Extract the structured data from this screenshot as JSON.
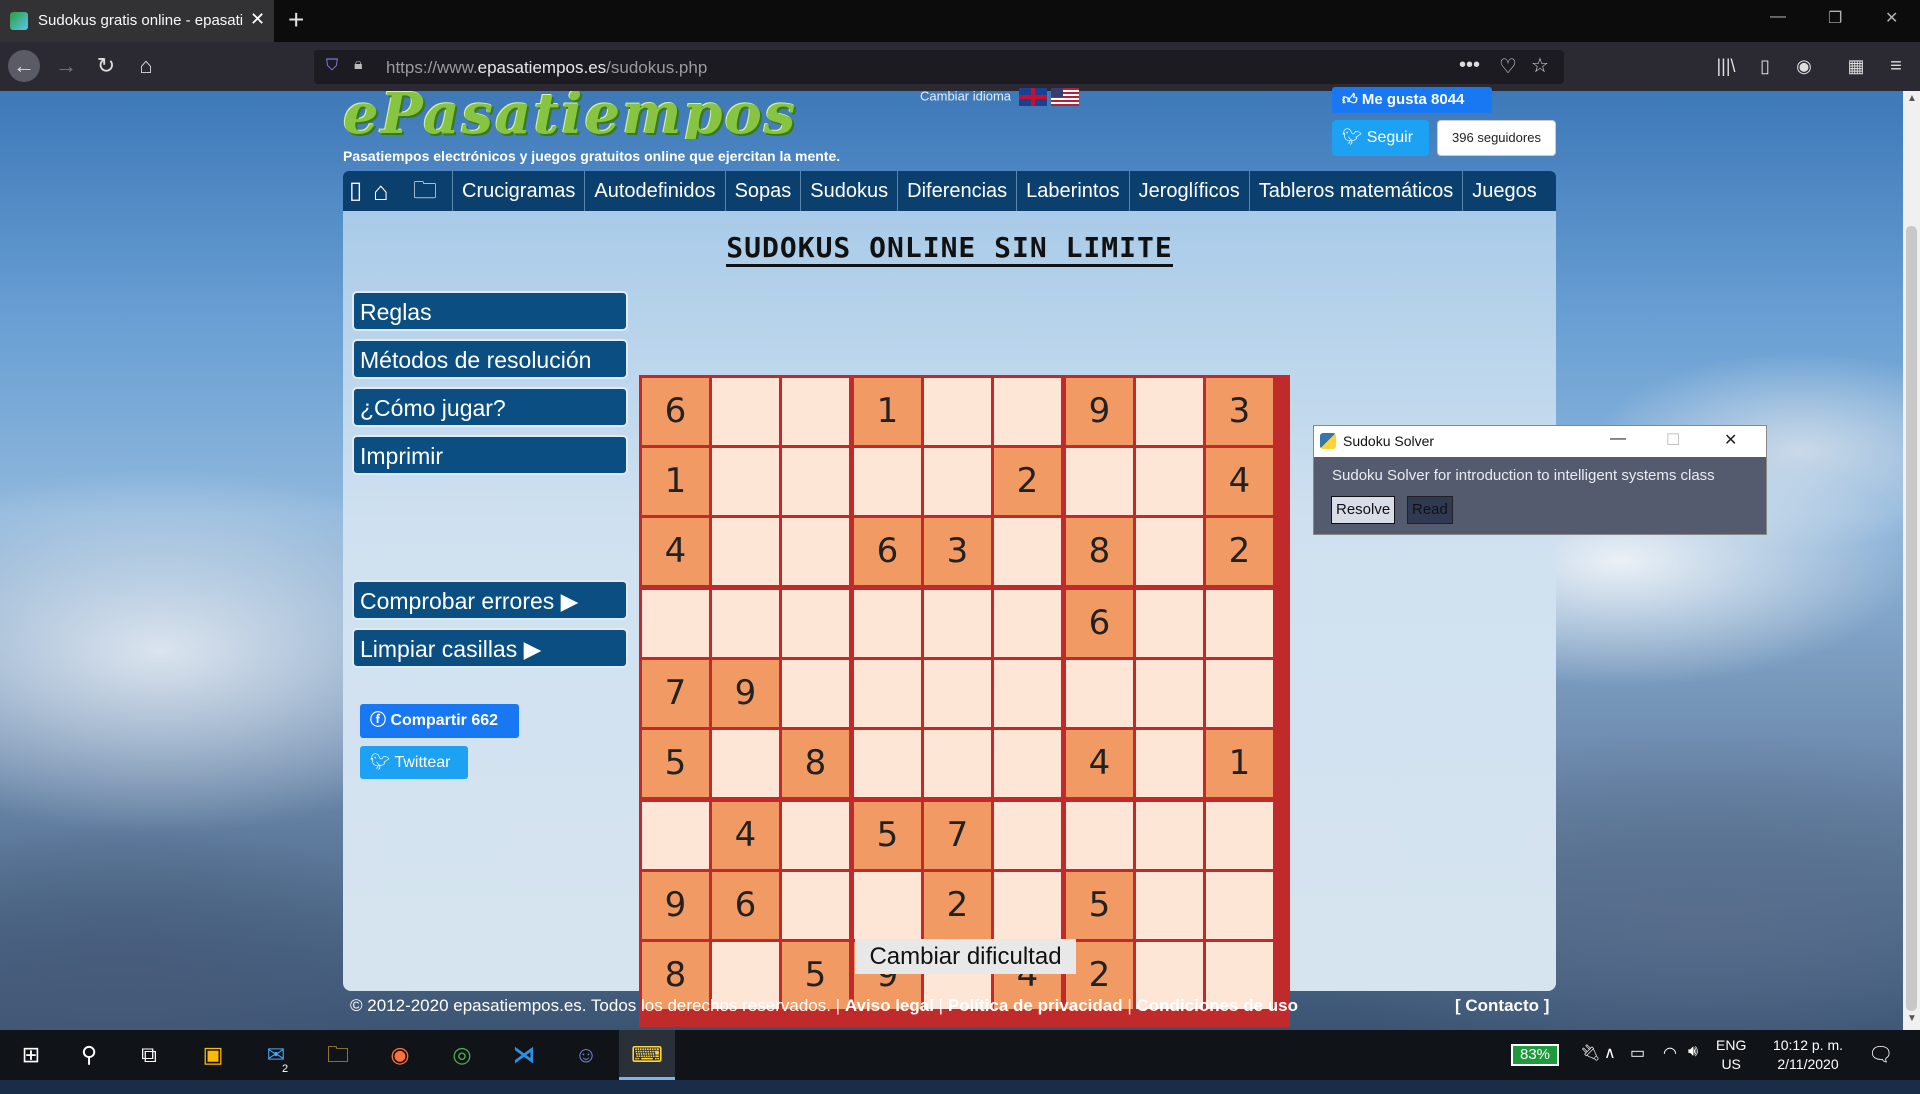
{
  "browser": {
    "tab_title": "Sudokus gratis online - epasatiempos",
    "url_prefix": "https://www.",
    "url_domain": "epasatiempos.es",
    "url_path": "/sudokus.php"
  },
  "site": {
    "logo": "ePasatiempos",
    "tagline": "Pasatiempos electrónicos y juegos gratuitos online que ejercitan la mente.",
    "language_label": "Cambiar idioma",
    "fb_like": "Me gusta 8044",
    "twitter_follow": "Seguir",
    "twitter_followers": "396 seguidores",
    "nav": [
      "Crucigramas",
      "Autodefinidos",
      "Sopas",
      "Sudokus",
      "Diferencias",
      "Laberintos",
      "Jeroglíficos",
      "Tableros matemáticos",
      "Juegos"
    ],
    "page_title": "SUDOKUS ONLINE SIN LIMITE",
    "side_buttons": [
      "Reglas",
      "Métodos de resolución",
      "¿Cómo jugar?",
      "Imprimir"
    ],
    "action_buttons": [
      "Comprobar errores ▶",
      "Limpiar casillas ▶"
    ],
    "share_label": "Compartir 662",
    "tweet_label": "Twittear",
    "change_difficulty": "Cambiar dificultad",
    "footer_text": "© 2012-2020 epasatiempos.es. Todos los derechos reservados. | ",
    "footer_links": [
      "Aviso legal",
      "Política de privacidad",
      "Condiciones de uso"
    ],
    "contact": "[ Contacto ]"
  },
  "sudoku": {
    "rows": [
      [
        "6",
        "",
        "",
        "1",
        "",
        "",
        "9",
        "",
        "3"
      ],
      [
        "1",
        "",
        "",
        "",
        "",
        "2",
        "",
        "",
        "4"
      ],
      [
        "4",
        "",
        "",
        "6",
        "3",
        "",
        "8",
        "",
        "2"
      ],
      [
        "",
        "",
        "",
        "",
        "",
        "",
        "6",
        "",
        ""
      ],
      [
        "7",
        "9",
        "",
        "",
        "",
        "",
        "",
        "",
        ""
      ],
      [
        "5",
        "",
        "8",
        "",
        "",
        "",
        "4",
        "",
        "1"
      ],
      [
        "",
        "4",
        "",
        "5",
        "7",
        "",
        "",
        "",
        ""
      ],
      [
        "9",
        "6",
        "",
        "",
        "2",
        "",
        "5",
        "",
        ""
      ],
      [
        "8",
        "",
        "5",
        "9",
        "",
        "4",
        "2",
        "",
        ""
      ]
    ]
  },
  "solver": {
    "title": "Sudoku Solver",
    "message": "Sudoku Solver for introduction to intelligent systems class",
    "resolve": "Resolve",
    "read": "Read"
  },
  "taskbar": {
    "battery": "83%",
    "lang_top": "ENG",
    "lang_bottom": "US",
    "time": "10:12 p. m.",
    "date": "2/11/2020",
    "mail_badge": "2"
  }
}
